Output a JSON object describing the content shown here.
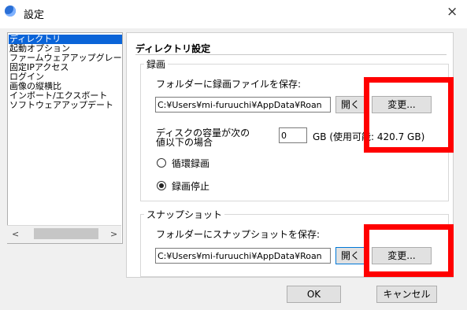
{
  "window": {
    "title": "設定",
    "close_label": "×"
  },
  "sidebar": {
    "items": [
      {
        "label": "ディレクトリ",
        "selected": true
      },
      {
        "label": "起動オプション"
      },
      {
        "label": "ファームウェアアップグレード"
      },
      {
        "label": "固定IPアクセス"
      },
      {
        "label": "ログイン"
      },
      {
        "label": "画像の縦横比"
      },
      {
        "label": "インポート/エクスポート"
      },
      {
        "label": "ソフトウェアアップデート"
      }
    ],
    "scroll_left": "<",
    "scroll_right": ">"
  },
  "panel": {
    "title": "ディレクトリ設定",
    "recording": {
      "legend": "録画",
      "save_label": "フォルダーに録画ファイルを保存:",
      "path": "C:¥Users¥mi-furuuchi¥AppData¥Roan",
      "open_button": "開く",
      "change_button": "変更...",
      "disk_label_line1": "ディスクの容量が次の",
      "disk_label_line2": "値以下の場合",
      "disk_value": "0",
      "disk_unit": "GB (使用可能: 420.7 GB)",
      "radio_loop": "循環録画",
      "radio_stop": "録画停止",
      "selected_radio": "録画停止"
    },
    "snapshot": {
      "legend": "スナップショット",
      "save_label": "フォルダーにスナップショットを保存:",
      "path": "C:¥Users¥mi-furuuchi¥AppData¥Roan",
      "open_button": "開く",
      "change_button": "変更..."
    }
  },
  "footer": {
    "ok_button": "OK",
    "cancel_button": "キャンセル"
  },
  "colors": {
    "highlight": "#ff0000",
    "selection": "#0a64d8"
  }
}
